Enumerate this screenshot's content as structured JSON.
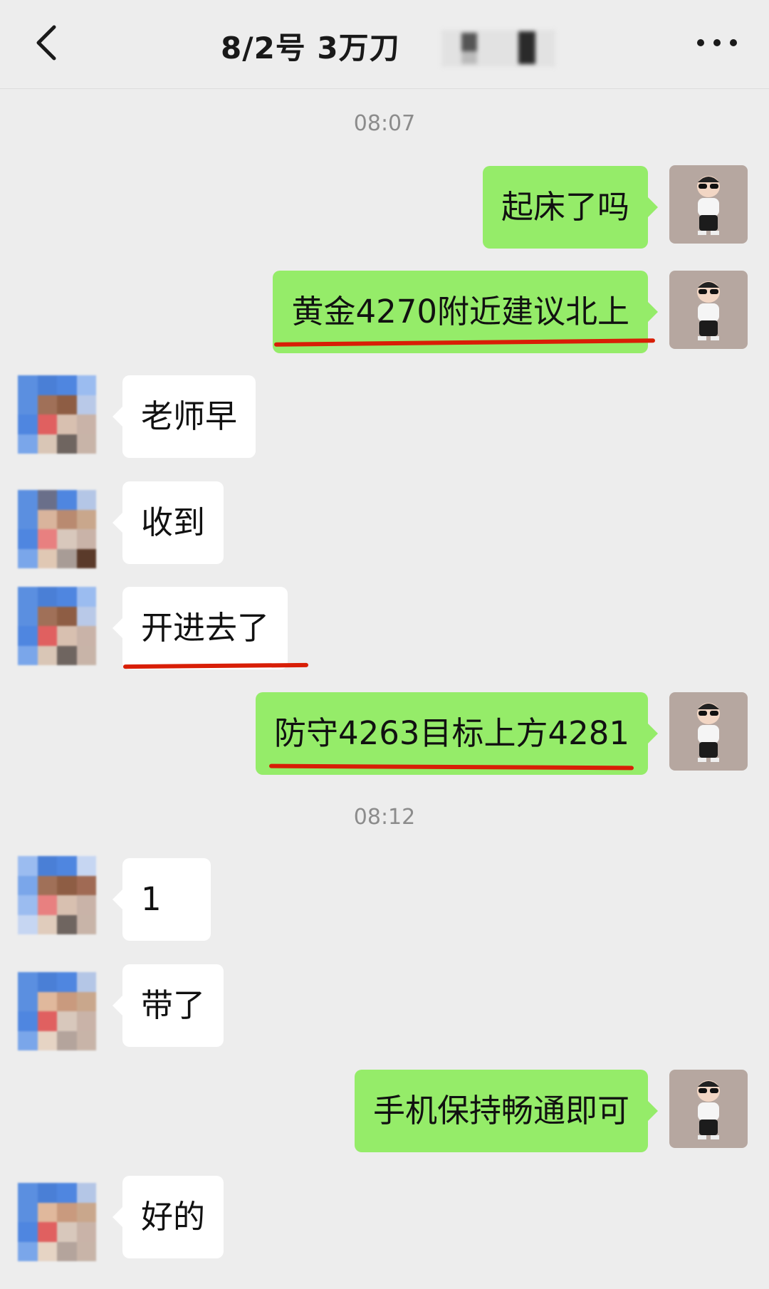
{
  "header": {
    "title": "8/2号  3万刀",
    "back_icon": "chevron-left-icon",
    "more_icon": "more-dots-icon"
  },
  "timestamps": [
    "08:07",
    "08:12"
  ],
  "messages": [
    {
      "from": "me",
      "text": "起床了吗"
    },
    {
      "from": "me",
      "text": "黄金4270附近建议北上"
    },
    {
      "from": "other",
      "text": "老师早"
    },
    {
      "from": "other",
      "text": "收到"
    },
    {
      "from": "other",
      "text": "开进去了"
    },
    {
      "from": "me",
      "text": "防守4263目标上方4281"
    },
    {
      "from": "other",
      "text": "1"
    },
    {
      "from": "other",
      "text": "带了"
    },
    {
      "from": "me",
      "text": "手机保持畅通即可"
    },
    {
      "from": "other",
      "text": "好的"
    }
  ],
  "colors": {
    "background": "#ededed",
    "my_bubble": "#95ec69",
    "other_bubble": "#ffffff",
    "underline": "#d81e06"
  }
}
